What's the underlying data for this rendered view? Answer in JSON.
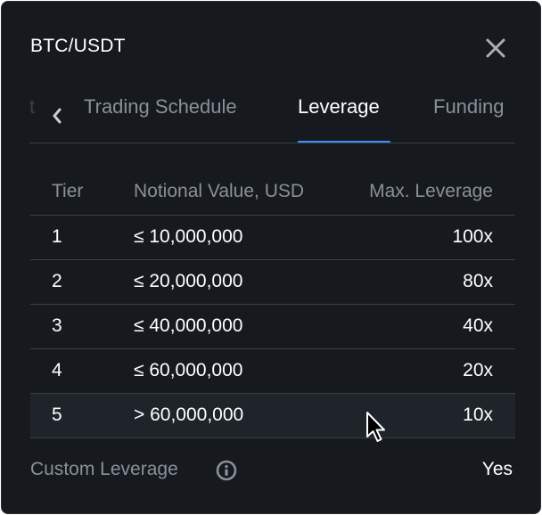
{
  "dialog": {
    "title": "BTC/USDT",
    "close_icon": "close-icon"
  },
  "tabs": {
    "items": [
      {
        "label": "t",
        "active": false
      },
      {
        "label": "Trading Schedule",
        "active": false
      },
      {
        "label": "Leverage",
        "active": true
      },
      {
        "label": "Funding",
        "active": false
      }
    ],
    "scroll_icon": "chevron-left-icon"
  },
  "table": {
    "headers": [
      "Tier",
      "Notional Value, USD",
      "Max. Leverage"
    ],
    "rows": [
      {
        "tier": "1",
        "notional": "≤ 10,000,000",
        "leverage": "100x"
      },
      {
        "tier": "2",
        "notional": "≤ 20,000,000",
        "leverage": "80x"
      },
      {
        "tier": "3",
        "notional": "≤ 40,000,000",
        "leverage": "40x"
      },
      {
        "tier": "4",
        "notional": "≤ 60,000,000",
        "leverage": "20x"
      },
      {
        "tier": "5",
        "notional": "> 60,000,000",
        "leverage": "10x"
      }
    ]
  },
  "footer": {
    "label": "Custom Leverage",
    "value": "Yes",
    "info_icon": "info-icon"
  },
  "colors": {
    "background": "#161a1f",
    "accent": "#3d8ef5",
    "muted_text": "#8a9099",
    "text": "#ffffff"
  }
}
